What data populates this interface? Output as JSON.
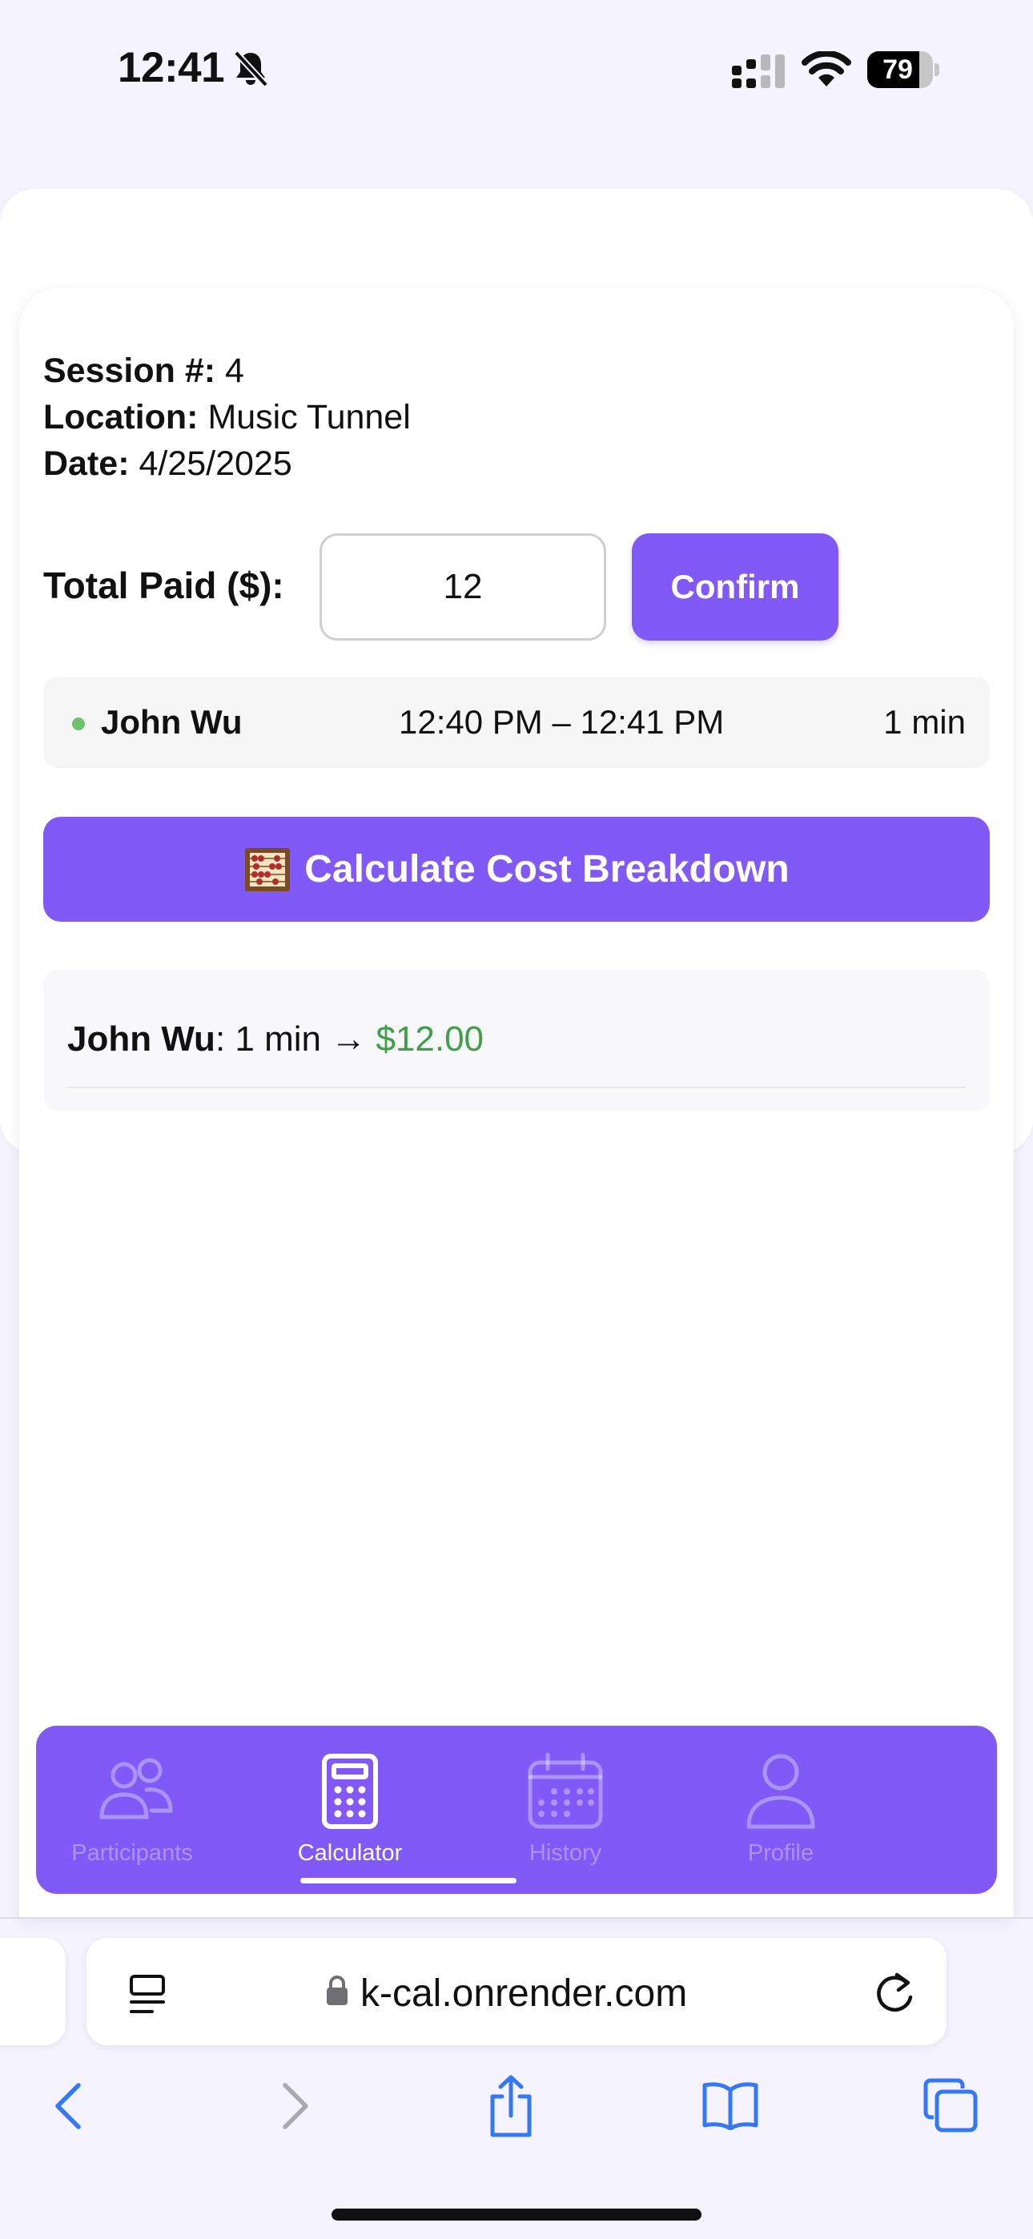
{
  "status_bar": {
    "time": "12:41",
    "battery_percent": 79,
    "battery_text": "79"
  },
  "session": {
    "number_label": "Session #:",
    "number_value": "4",
    "location_label": "Location:",
    "location_value": "Music Tunnel",
    "date_label": "Date:",
    "date_value": "4/25/2025"
  },
  "payment": {
    "label": "Total Paid ($):",
    "value": "12",
    "confirm_label": "Confirm"
  },
  "participants": [
    {
      "name": "John Wu",
      "time_range": "12:40 PM – 12:41 PM",
      "duration": "1 min",
      "status_color": "#6cc270"
    }
  ],
  "calculate_button": {
    "icon": "🧮",
    "label": "Calculate Cost Breakdown"
  },
  "results": [
    {
      "name": "John Wu",
      "detail": ": 1 min → ",
      "amount": "$12.00"
    }
  ],
  "nav": {
    "items": [
      {
        "label": "Participants",
        "icon": "participants-icon",
        "active": false
      },
      {
        "label": "Calculator",
        "icon": "calculator-icon",
        "active": true
      },
      {
        "label": "History",
        "icon": "calendar-icon",
        "active": false
      },
      {
        "label": "Profile",
        "icon": "profile-icon",
        "active": false
      }
    ]
  },
  "browser": {
    "url": "k-cal.onrender.com"
  },
  "colors": {
    "accent": "#8059f7",
    "amount": "#3f9e4a",
    "browser_blue": "#3478f6"
  }
}
